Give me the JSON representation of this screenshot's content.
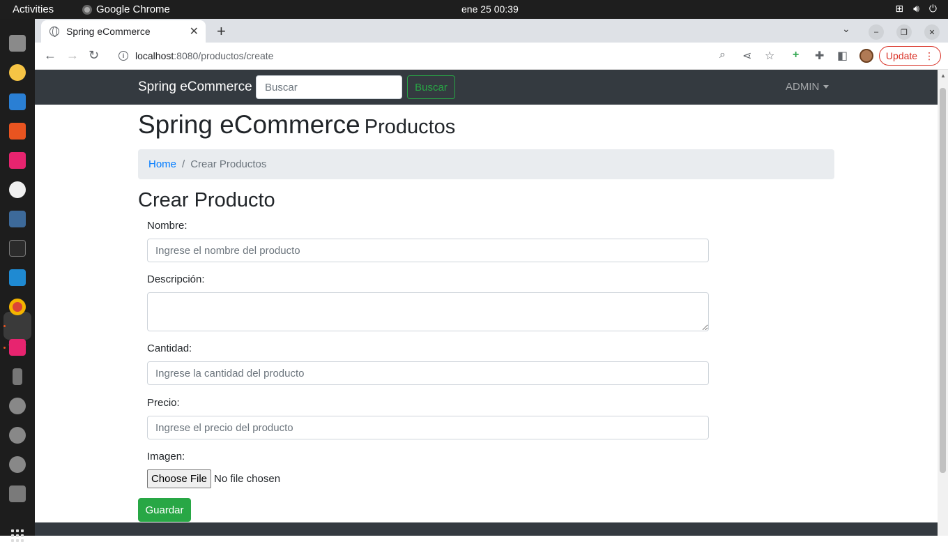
{
  "system": {
    "activities": "Activities",
    "app_name": "Google Chrome",
    "clock": "ene 25  00:39"
  },
  "browser": {
    "tab_title": "Spring eCommerce",
    "url_host": "localhost",
    "url_path": ":8080/productos/create",
    "update_label": "Update"
  },
  "site": {
    "brand": "Spring eCommerce",
    "search_placeholder": "Buscar",
    "search_button": "Buscar",
    "admin_menu": "ADMIN"
  },
  "page": {
    "heading": "Spring eCommerce",
    "heading_small": "Productos",
    "breadcrumb_home": "Home",
    "breadcrumb_sep": "/",
    "breadcrumb_current": "Crear Productos",
    "form_title": "Crear Producto"
  },
  "form": {
    "nombre_label": "Nombre:",
    "nombre_placeholder": "Ingrese el nombre del producto",
    "descripcion_label": "Descripción:",
    "cantidad_label": "Cantidad:",
    "cantidad_placeholder": "Ingrese la cantidad del producto",
    "precio_label": "Precio:",
    "precio_placeholder": "Ingrese el precio del producto",
    "imagen_label": "Imagen:",
    "file_button": "Choose File",
    "file_status": "No file chosen",
    "submit": "Guardar"
  },
  "colors": {
    "navbar": "#343a40",
    "success": "#28a745",
    "link": "#007bff",
    "breadcrumb_bg": "#e9ecef",
    "update_red": "#d93025"
  }
}
